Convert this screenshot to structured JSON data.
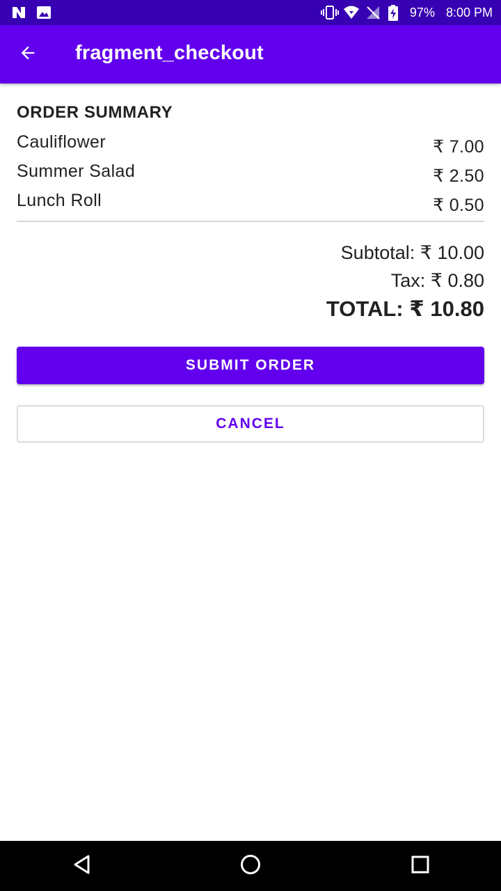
{
  "status_bar": {
    "battery": "97%",
    "time": "8:00 PM"
  },
  "app_bar": {
    "title": "fragment_checkout",
    "back_icon": "arrow-back-icon"
  },
  "order_summary": {
    "heading": "ORDER SUMMARY",
    "items": [
      {
        "name": "Cauliflower",
        "price": "₹ 7.00"
      },
      {
        "name": "Summer Salad",
        "price": "₹ 2.50"
      },
      {
        "name": "Lunch Roll",
        "price": "₹ 0.50"
      }
    ],
    "subtotal": "Subtotal: ₹ 10.00",
    "tax": "Tax: ₹ 0.80",
    "total": "TOTAL: ₹ 10.80"
  },
  "buttons": {
    "submit": "SUBMIT ORDER",
    "cancel": "CANCEL"
  },
  "colors": {
    "primary": "#6200ee",
    "primary_dark": "#3700b3"
  },
  "nav_bar": {
    "back_icon": "nav-back-icon",
    "home_icon": "nav-home-icon",
    "recents_icon": "nav-recents-icon"
  }
}
